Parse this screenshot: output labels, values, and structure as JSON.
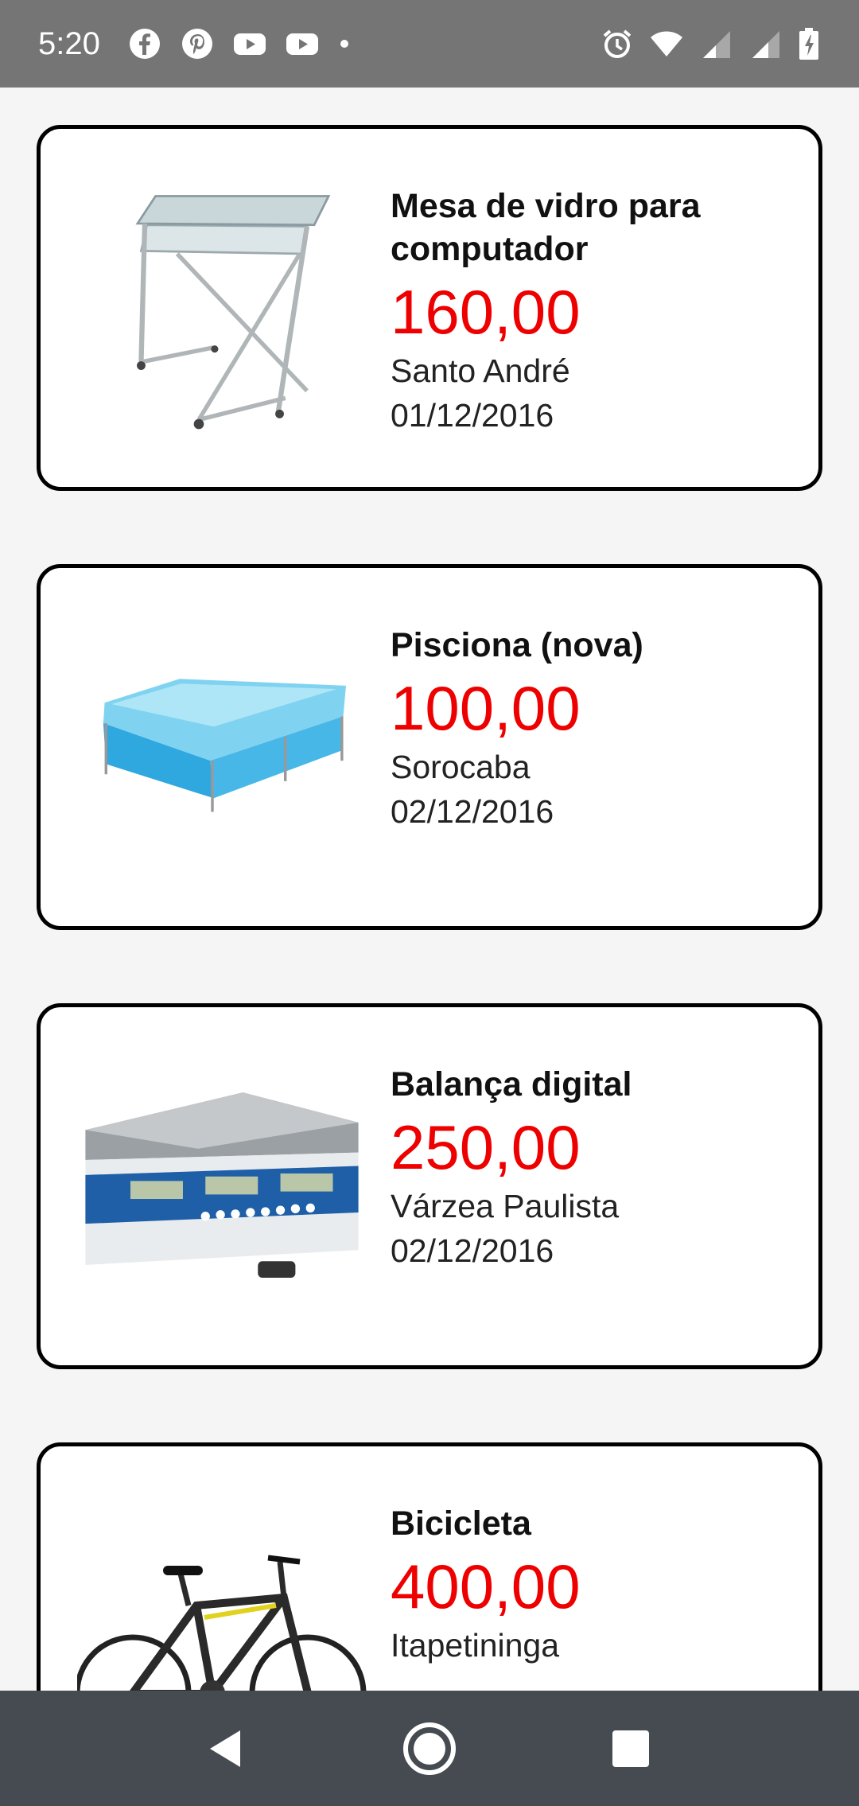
{
  "status_bar": {
    "time": "5:20",
    "left_icons": [
      "facebook-icon",
      "pinterest-icon",
      "youtube-icon",
      "youtube-icon"
    ],
    "right_icons": [
      "alarm-icon",
      "wifi-icon",
      "signal-icon",
      "signal-icon",
      "battery-icon"
    ]
  },
  "listings": [
    {
      "title": "Mesa de vidro para computador",
      "price": "160,00",
      "city": "Santo André",
      "date": "01/12/2016",
      "image": "glass-desk-image"
    },
    {
      "title": "Pisciona (nova)",
      "price": "100,00",
      "city": "Sorocaba",
      "date": "02/12/2016",
      "image": "pool-image"
    },
    {
      "title": "Balança digital",
      "price": "250,00",
      "city": "Várzea Paulista",
      "date": "02/12/2016",
      "image": "digital-scale-image"
    },
    {
      "title": "Bicicleta",
      "price": "400,00",
      "city": "Itapetininga",
      "date": "",
      "image": "bicycle-image"
    }
  ],
  "nav_bar": {
    "buttons": [
      "back-icon",
      "home-icon",
      "recents-icon"
    ]
  },
  "colors": {
    "price": "#ee0000",
    "status_bar": "#757575",
    "nav_bar": "#454b50",
    "card_border": "#000000"
  }
}
